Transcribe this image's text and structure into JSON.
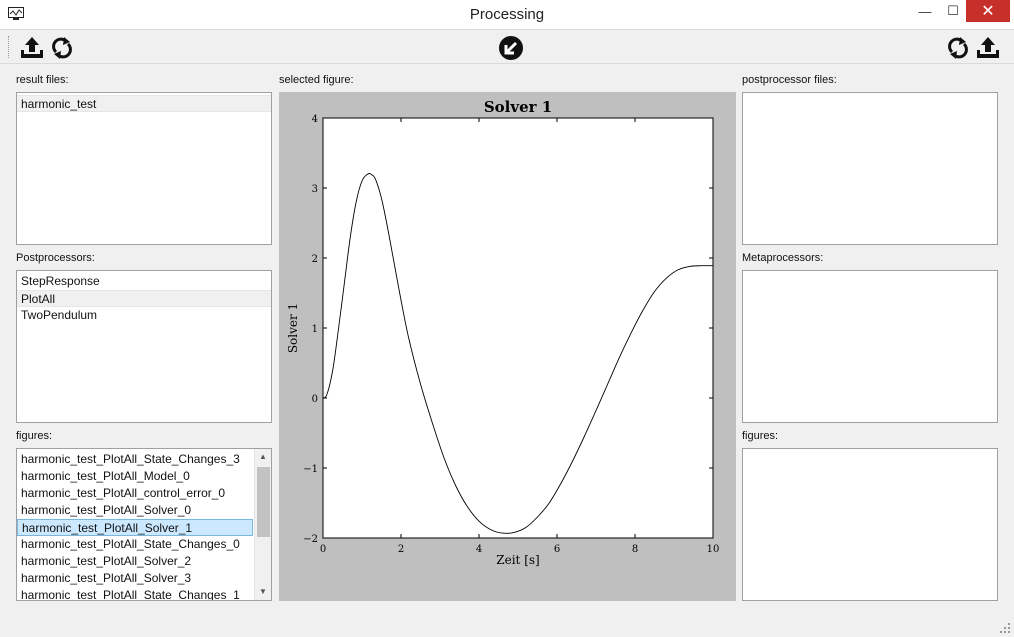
{
  "window": {
    "title": "Processing",
    "minimize": "—",
    "maximize": "☐",
    "close": "✕"
  },
  "toolbar": {
    "left_icons": [
      "upload-icon",
      "refresh-icon"
    ],
    "center_icon": "arrow-down-left-circle-icon",
    "right_icons": [
      "refresh-icon",
      "upload-icon"
    ]
  },
  "result_files": {
    "label": "result files:",
    "items": [
      "harmonic_test"
    ]
  },
  "postprocessors": {
    "label": "Postprocessors:",
    "items": [
      "StepResponse",
      "PlotAll",
      "TwoPendulum"
    ]
  },
  "figures_left": {
    "label": "figures:",
    "items": [
      "harmonic_test_PlotAll_State_Changes_3",
      "harmonic_test_PlotAll_Model_0",
      "harmonic_test_PlotAll_control_error_0",
      "harmonic_test_PlotAll_Solver_0",
      "harmonic_test_PlotAll_Solver_1",
      "harmonic_test_PlotAll_State_Changes_0",
      "harmonic_test_PlotAll_Solver_2",
      "harmonic_test_PlotAll_Solver_3",
      "harmonic_test_PlotAll_State_Changes_1"
    ],
    "selected": "harmonic_test_PlotAll_Solver_1"
  },
  "selected_figure": {
    "label": "selected figure:"
  },
  "postprocessor_files": {
    "label": "postprocessor files:",
    "items": []
  },
  "metaprocessors": {
    "label": "Metaprocessors:",
    "items": []
  },
  "figures_right": {
    "label": "figures:",
    "items": []
  },
  "colors": {
    "selection": "#cce8ff",
    "figure_background": "#bfbfbf",
    "close_button": "#c7302a"
  },
  "chart_data": {
    "type": "line",
    "title": "Solver 1",
    "xlabel": "Zeit [s]",
    "ylabel": "Solver 1",
    "xlim": [
      0,
      10
    ],
    "ylim": [
      -2,
      4
    ],
    "xticks": [
      "0",
      "2",
      "4",
      "6",
      "8",
      "10"
    ],
    "yticks": [
      "−2",
      "−1",
      "0",
      "1",
      "2",
      "3",
      "4"
    ],
    "grid": false,
    "series": [
      {
        "name": "",
        "x": [
          0,
          0.1,
          0.25,
          0.4,
          0.55,
          0.7,
          0.85,
          1.0,
          1.15,
          1.25,
          1.35,
          1.5,
          1.65,
          1.8,
          2.0,
          2.2,
          2.5,
          2.8,
          3.1,
          3.4,
          3.7,
          4.0,
          4.3,
          4.6,
          4.9,
          5.2,
          5.5,
          5.8,
          6.1,
          6.4,
          6.7,
          7.0,
          7.3,
          7.6,
          7.9,
          8.2,
          8.5,
          8.8,
          9.1,
          9.4,
          9.7,
          10.0
        ],
        "y": [
          0.0,
          0.05,
          0.4,
          1.0,
          1.65,
          2.3,
          2.8,
          3.1,
          3.2,
          3.19,
          3.12,
          2.85,
          2.45,
          2.0,
          1.4,
          0.85,
          0.2,
          -0.35,
          -0.85,
          -1.25,
          -1.55,
          -1.76,
          -1.88,
          -1.93,
          -1.92,
          -1.85,
          -1.7,
          -1.5,
          -1.22,
          -0.9,
          -0.55,
          -0.18,
          0.2,
          0.58,
          0.93,
          1.25,
          1.52,
          1.71,
          1.83,
          1.88,
          1.89,
          1.89
        ]
      }
    ]
  }
}
